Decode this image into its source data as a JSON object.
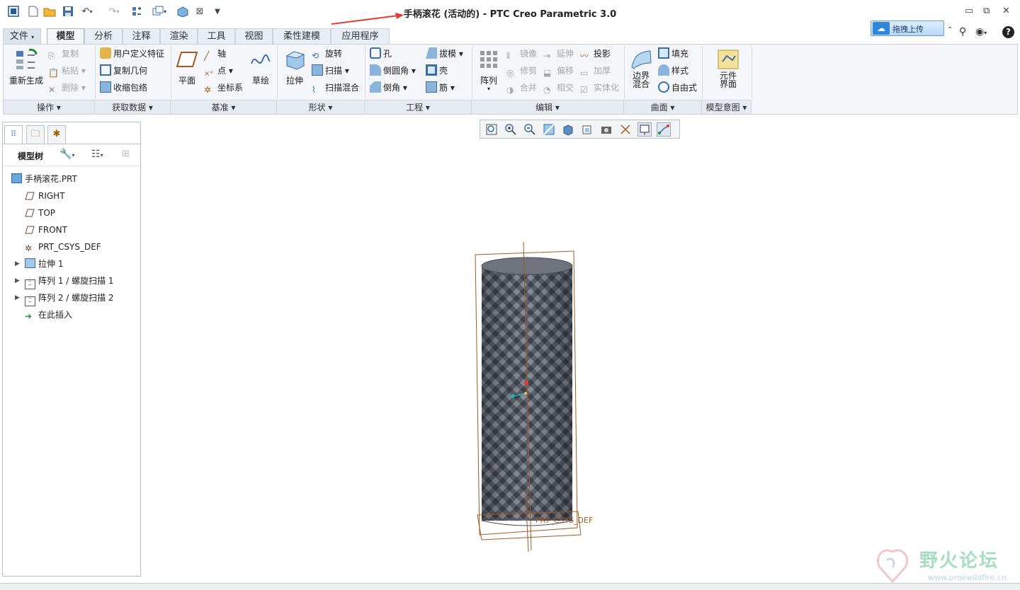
{
  "app": {
    "title": "手柄滚花 (活动的) - PTC Creo Parametric 3.0"
  },
  "quick_access": {
    "icons": [
      "window-icon",
      "new-file-icon",
      "open-folder-icon",
      "save-icon",
      "undo-icon",
      "redo-icon",
      "regenerate-icon",
      "windows-switch-icon",
      "model-icon",
      "close-window-icon",
      "customize-icon"
    ]
  },
  "upload": {
    "label": "拖拽上传"
  },
  "tabs": [
    {
      "label": "文件"
    },
    {
      "label": "模型"
    },
    {
      "label": "分析"
    },
    {
      "label": "注释"
    },
    {
      "label": "渲染"
    },
    {
      "label": "工具"
    },
    {
      "label": "视图"
    },
    {
      "label": "柔性建模"
    },
    {
      "label": "应用程序"
    }
  ],
  "ribbon": {
    "operations": {
      "regenerate": "重新生成",
      "copy": "复制",
      "paste": "粘贴",
      "delete": "删除",
      "group": "操作"
    },
    "get_data": {
      "udf": "用户定义特征",
      "copy_geom": "复制几何",
      "shrinkwrap": "收缩包络",
      "group": "获取数据"
    },
    "datum": {
      "plane": "平面",
      "axis": "轴",
      "point": "点",
      "csys": "坐标系",
      "sketch": "草绘",
      "group": "基准"
    },
    "shapes": {
      "extrude": "拉伸",
      "revolve": "旋转",
      "sweep": "扫描",
      "swept_blend": "扫描混合",
      "group": "形状"
    },
    "engineering": {
      "hole": "孔",
      "round": "倒圆角",
      "chamfer": "倒角",
      "draft": "拔模",
      "shell": "壳",
      "rib": "筋",
      "group": "工程"
    },
    "editing": {
      "pattern": "阵列",
      "mirror": "镜像",
      "trim": "修剪",
      "merge": "合并",
      "extend": "延伸",
      "offset": "偏移",
      "intersect": "相交",
      "project": "投影",
      "thicken": "加厚",
      "solidify": "实体化",
      "group": "编辑"
    },
    "surfaces": {
      "boundary_blend": "边界\n混合",
      "fill": "填充",
      "style": "样式",
      "freestyle": "自由式",
      "group": "曲面"
    },
    "intent": {
      "component_interface": "元件\n界面",
      "group": "模型意图"
    }
  },
  "panel": {
    "title": "模型树",
    "tree": [
      {
        "label": "手柄滚花.PRT",
        "icon": "part-icon"
      },
      {
        "label": "RIGHT",
        "icon": "datum-plane-icon"
      },
      {
        "label": "TOP",
        "icon": "datum-plane-icon"
      },
      {
        "label": "FRONT",
        "icon": "datum-plane-icon"
      },
      {
        "label": "PRT_CSYS_DEF",
        "icon": "csys-icon"
      },
      {
        "label": "拉伸 1",
        "icon": "extrude-icon"
      },
      {
        "label": "阵列 1 / 螺旋扫描 1",
        "icon": "pattern-icon"
      },
      {
        "label": "阵列 2 / 螺旋扫描 2",
        "icon": "pattern-icon"
      },
      {
        "label": "在此插入",
        "icon": "insert-arrow-icon"
      }
    ]
  },
  "viewport": {
    "csys_label": "PRT_CSYS_DEF"
  },
  "watermark": {
    "text": "野火论坛",
    "url": "www.proewildfire.cn"
  },
  "colors": {
    "accent": "#2e86d8",
    "annotation_arrow": "#e53935",
    "model_gray": "#5d626d",
    "datum_brown": "#a35a20"
  }
}
